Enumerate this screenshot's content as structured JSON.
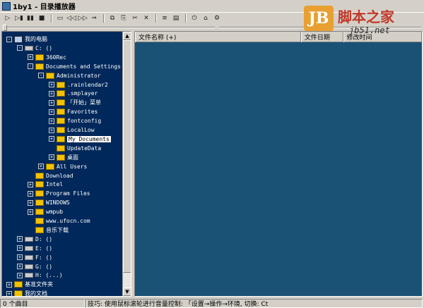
{
  "window": {
    "title": "1by1 - 目录播放器"
  },
  "toolbar": {
    "buttons": [
      {
        "name": "play-button",
        "glyph": "▷"
      },
      {
        "name": "play-pause-button",
        "glyph": "▷▮"
      },
      {
        "name": "pause-button",
        "glyph": "▮▮"
      },
      {
        "name": "stop-button",
        "glyph": "■"
      },
      {
        "name": "folder-button",
        "glyph": "▭"
      },
      {
        "name": "prev-button",
        "glyph": "◁◁"
      },
      {
        "name": "next-button",
        "glyph": "▷▷"
      },
      {
        "name": "skip-button",
        "glyph": "⇒"
      },
      {
        "name": "copy-button",
        "glyph": "⧉"
      },
      {
        "name": "paste-button",
        "glyph": "⎘"
      },
      {
        "name": "cut-button",
        "glyph": "✂"
      },
      {
        "name": "delete-button",
        "glyph": "✕"
      },
      {
        "name": "list-button",
        "glyph": "≡"
      },
      {
        "name": "props-button",
        "glyph": "▤"
      },
      {
        "name": "power-button",
        "glyph": "⏻"
      },
      {
        "name": "home-button",
        "glyph": "⌂"
      },
      {
        "name": "settings-button",
        "glyph": "⚙"
      }
    ]
  },
  "seek": {
    "position": 0.0,
    "volume": 0.5
  },
  "tree": {
    "items": [
      {
        "label": "我的电脑",
        "level": 0,
        "icon": "pc",
        "exp": "-"
      },
      {
        "label": "C: ()",
        "level": 1,
        "icon": "drive",
        "exp": "-"
      },
      {
        "label": "360Rec",
        "level": 2,
        "icon": "folder",
        "exp": "+"
      },
      {
        "label": "Documents and Settings",
        "level": 2,
        "icon": "folder",
        "exp": "-"
      },
      {
        "label": "Administrator",
        "level": 3,
        "icon": "folder",
        "exp": "-"
      },
      {
        "label": ".rainlendar2",
        "level": 4,
        "icon": "folder",
        "exp": "+"
      },
      {
        "label": ".smplayer",
        "level": 4,
        "icon": "folder",
        "exp": "+"
      },
      {
        "label": "「开始」菜单",
        "level": 4,
        "icon": "folder",
        "exp": "+"
      },
      {
        "label": "Favorites",
        "level": 4,
        "icon": "folder",
        "exp": "+"
      },
      {
        "label": "fontconfig",
        "level": 4,
        "icon": "folder",
        "exp": "+"
      },
      {
        "label": "LocalLow",
        "level": 4,
        "icon": "folder",
        "exp": "+"
      },
      {
        "label": "My Documents",
        "level": 4,
        "icon": "folder",
        "exp": "+",
        "selected": true
      },
      {
        "label": "UpdateData",
        "level": 4,
        "icon": "folder",
        "exp": ""
      },
      {
        "label": "桌面",
        "level": 4,
        "icon": "folder",
        "exp": "+"
      },
      {
        "label": "All Users",
        "level": 3,
        "icon": "folder",
        "exp": "+"
      },
      {
        "label": "Download",
        "level": 2,
        "icon": "folder",
        "exp": ""
      },
      {
        "label": "Intel",
        "level": 2,
        "icon": "folder",
        "exp": "+"
      },
      {
        "label": "Program Files",
        "level": 2,
        "icon": "folder",
        "exp": "+"
      },
      {
        "label": "WINDOWS",
        "level": 2,
        "icon": "folder",
        "exp": "+"
      },
      {
        "label": "wmpub",
        "level": 2,
        "icon": "folder",
        "exp": "+"
      },
      {
        "label": "www.ufocn.com",
        "level": 2,
        "icon": "folder",
        "exp": ""
      },
      {
        "label": "音乐下载",
        "level": 2,
        "icon": "folder",
        "exp": ""
      },
      {
        "label": "D: ()",
        "level": 1,
        "icon": "drive",
        "exp": "+"
      },
      {
        "label": "E: ()",
        "level": 1,
        "icon": "drive",
        "exp": "+"
      },
      {
        "label": "F: ()",
        "level": 1,
        "icon": "drive",
        "exp": "+"
      },
      {
        "label": "G: ()",
        "level": 1,
        "icon": "drive",
        "exp": "+"
      },
      {
        "label": "H: (...)",
        "level": 1,
        "icon": "drive",
        "exp": "+"
      },
      {
        "label": "基准文件夹",
        "level": 0,
        "icon": "folder",
        "exp": "+"
      },
      {
        "label": "我的文档",
        "level": 0,
        "icon": "folder",
        "exp": "+"
      }
    ]
  },
  "list": {
    "columns": [
      {
        "label": "文件名称 (+)"
      },
      {
        "label": "文件日期"
      },
      {
        "label": "修改时间"
      }
    ]
  },
  "watermark": {
    "logo": "JB",
    "text": "脚本之家",
    "url": "jb51.net"
  },
  "status": {
    "count": "0 个曲目",
    "tip": "技巧: 使用鼠标滚轮进行音量控制: 「设置→操作→环境, 切换: Ct"
  }
}
